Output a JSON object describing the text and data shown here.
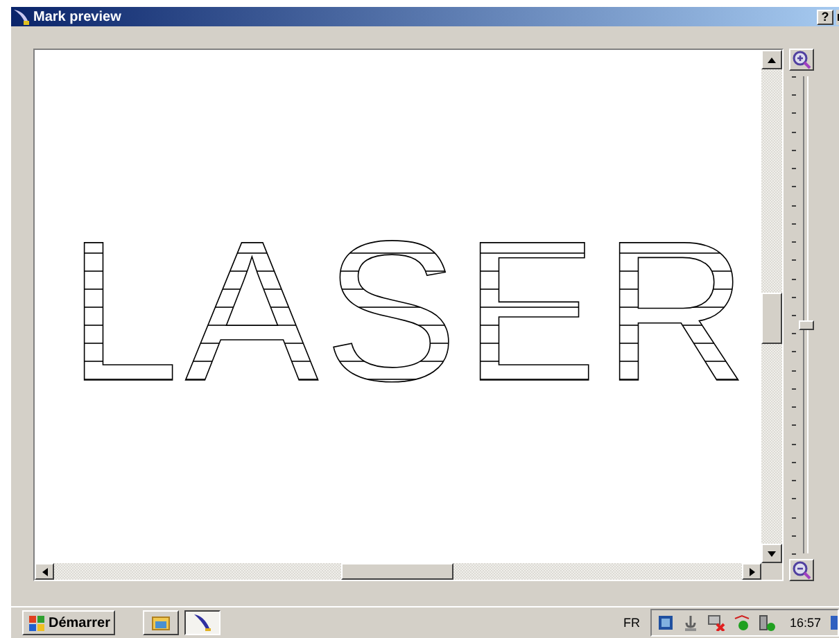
{
  "window": {
    "title": "Mark preview",
    "help_button": "?"
  },
  "preview": {
    "mark_text": "LASER"
  },
  "zoom_slider": {
    "level": 0.48
  },
  "taskbar": {
    "start_label": "Démarrer",
    "tasks": [
      {
        "kind": "folder",
        "selected": false
      },
      {
        "kind": "feather",
        "selected": true
      }
    ],
    "language": "FR",
    "clock": "16:57"
  }
}
